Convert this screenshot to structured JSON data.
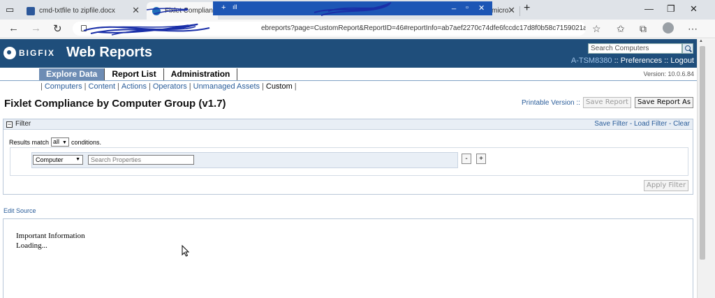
{
  "browser": {
    "tabs": [
      {
        "title": "cmd-txtfile to zipfile.docx",
        "close": "✕",
        "state": "inactive"
      },
      {
        "title": "Fixlet Complianc",
        "close": "✕",
        "state": "active"
      },
      {
        "title": "micro",
        "close": "✕",
        "state": "inactive"
      }
    ],
    "new_tab": "+",
    "window_controls": {
      "minimize": "—",
      "restore": "❐",
      "close": "✕"
    },
    "address": {
      "url_visible": "ebreports?page=CustomReport&ReportID=46#reportInfo=ab7aef2270c74dfe6fccdc17d8f0b58c7159021a"
    },
    "nav_icons": {
      "back": "←",
      "forward": "→",
      "reload": "↻"
    },
    "toolbar_icons": [
      "favorites-add-icon",
      "favorites-icon",
      "collections-icon",
      "profile-icon",
      "more-icon"
    ]
  },
  "rd_bar": {
    "pin": "+",
    "signal": "ıll",
    "minimize": "_",
    "restore": "▫",
    "close": "✕"
  },
  "header": {
    "brand": "BIGFIX",
    "title": "Web Reports",
    "search_placeholder": "Search Computers",
    "user": "A-TSM8380",
    "preferences": "Preferences",
    "logout": "Logout",
    "sep": " :: ",
    "version": "Version: 10.0.6.84"
  },
  "main_nav": {
    "items": [
      {
        "label": "Explore Data",
        "active": true
      },
      {
        "label": "Report List",
        "active": false
      },
      {
        "label": "Administration",
        "active": false
      }
    ]
  },
  "sub_nav": {
    "items": [
      "Computers",
      "Content",
      "Actions",
      "Operators",
      "Unmanaged Assets",
      "Custom"
    ],
    "current": "Custom"
  },
  "page": {
    "title": "Fixlet Compliance by Computer Group (v1.7)",
    "printable": "Printable Version ::",
    "save_report": "Save Report",
    "save_report_as": "Save Report As"
  },
  "filter": {
    "toggle": "−",
    "label": "Filter",
    "save_filter": "Save Filter",
    "load_filter": "Load Filter",
    "clear": "Clear",
    "link_sep": " - ",
    "match_prefix": "Results match",
    "match_value": "all",
    "match_suffix": "conditions.",
    "condition_field": "Computer",
    "condition_placeholder": "Search Properties",
    "remove_btn": "-",
    "add_btn": "+",
    "apply": "Apply Filter"
  },
  "edit_source": "Edit Source",
  "content": {
    "info_title": "Important Information",
    "loading": "Loading..."
  }
}
